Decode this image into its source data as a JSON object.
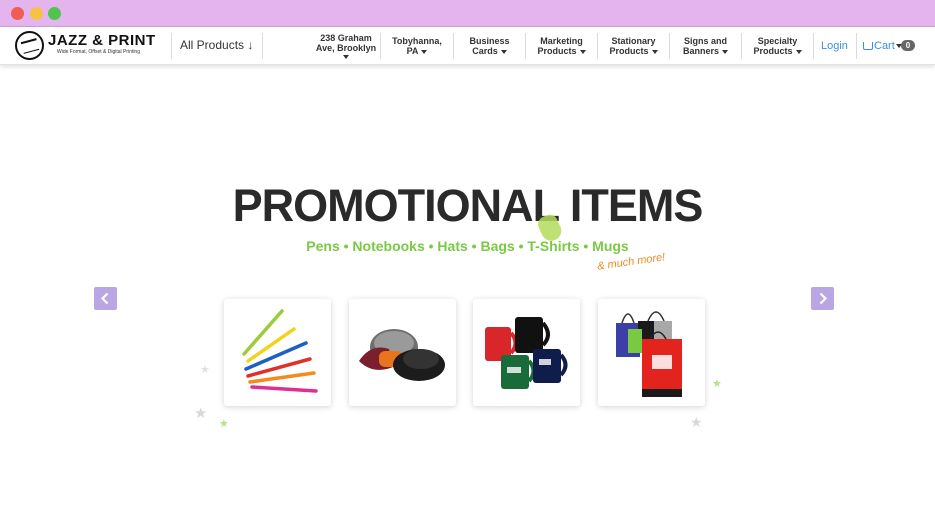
{
  "nav": {
    "logo_title": "JAZZ & PRINT",
    "logo_subtitle": "Wide Format, Offset & Digital Printing",
    "all_products": "All Products ↓",
    "items": [
      {
        "line1": "238 Graham",
        "line2": "Ave, Brooklyn"
      },
      {
        "line1": "Tobyhanna,",
        "line2": "PA"
      },
      {
        "line1": "Business",
        "line2": "Cards"
      },
      {
        "line1": "Marketing",
        "line2": "Products"
      },
      {
        "line1": "Stationary",
        "line2": "Products"
      },
      {
        "line1": "Signs and",
        "line2": "Banners"
      },
      {
        "line1": "Specialty",
        "line2": "Products"
      }
    ],
    "login": "Login",
    "cart": "Cart",
    "cart_count": "0"
  },
  "hero": {
    "title": "PROMOTIONAL ITEMS",
    "subtitle": "Pens • Notebooks • Hats • Bags • T-Shirts • Mugs",
    "tagline": "& much more!"
  },
  "products": [
    "pens-image",
    "hats-image",
    "mugs-image",
    "bags-image"
  ],
  "colors": {
    "titlebar": "#e3b4ee",
    "accent_green": "#7bc943",
    "accent_orange": "#f08a24",
    "link_blue": "#3a8fd6",
    "arrow_bg": "#b8a7e3",
    "heading": "#2a2a2a"
  },
  "icons": {
    "prev": "chevron-left-icon",
    "next": "chevron-right-icon",
    "cart": "cart-icon",
    "star": "star-icon"
  }
}
